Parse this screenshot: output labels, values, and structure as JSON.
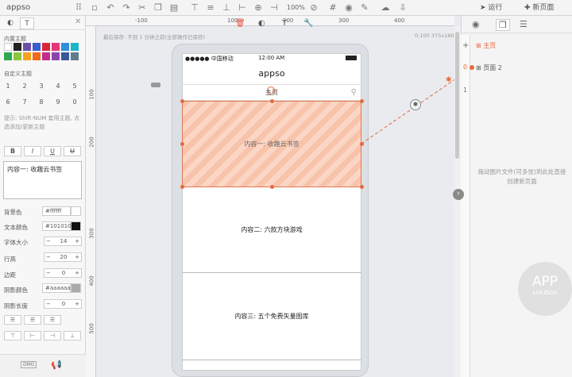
{
  "app": {
    "name": "appso"
  },
  "toolbar": {
    "zoom": "100%",
    "run_label": "运行",
    "new_page_label": "新页面"
  },
  "ruler": {
    "h": [
      "-100",
      "100",
      "200",
      "300",
      "400"
    ],
    "v": [
      "100",
      "200",
      "300",
      "400",
      "500"
    ]
  },
  "left_panel": {
    "text_tab": "T",
    "builtin_theme_label": "内置主题",
    "custom_theme_label": "自定义主题",
    "theme_colors": [
      "#ffffff",
      "#222222",
      "#6b4fa8",
      "#3a5fcd",
      "#d9263a",
      "#e6357a",
      "#2f8fd8",
      "#1fb5c9",
      "#2fa84f",
      "#8cc63e",
      "#f4a21c",
      "#f06a1d",
      "#c22c8c",
      "#8e44ad",
      "#3b5998",
      "#607d8b"
    ],
    "custom_slots": [
      "1",
      "2",
      "3",
      "4",
      "5",
      "6",
      "7",
      "8",
      "9",
      "0"
    ],
    "hint": "提示: Shift-NUM 套用主题, 点选添加/更新主题",
    "format_buttons": [
      "B",
      "I",
      "U",
      "U"
    ],
    "text_content": "内容一: 收趣云书签",
    "props": {
      "bg_label": "背景色",
      "bg_value": "#ffffff",
      "text_color_label": "文本颜色",
      "text_color_value": "#101010",
      "font_size_label": "字体大小",
      "font_size_value": "14",
      "line_height_label": "行高",
      "line_height_value": "20",
      "margin_label": "边距",
      "margin_value": "0",
      "shadow_color_label": "阴影颜色",
      "shadow_color_value": "#aaaaaa",
      "shadow_len_label": "阴影长度",
      "shadow_len_value": "0"
    },
    "bottom_label": "DMG"
  },
  "canvas": {
    "save_status": "最后保存: 不到 1 分钟之前(全部操作已保存)",
    "dims": "0:100 375x180"
  },
  "phone": {
    "carrier": "●●●●● 中国移动",
    "time": "12:00 AM",
    "title": "appso",
    "search_text": "主页",
    "content1": "内容一: 收趣云书签",
    "content2": "内容二: 六款方块游戏",
    "content3": "内容三: 五个免费矢量图库"
  },
  "right_panel": {
    "home_label": "主页",
    "page2_label": "页面 2",
    "gutter_nums": [
      "0",
      "1"
    ],
    "drop_hint": "拖动图片文件(可多张)到此处直接创建新页面",
    "watermark_top": "APP",
    "watermark_bottom": "solution"
  },
  "colors": {
    "accent": "#e46a3e",
    "selection_fill": "#f8c3aa"
  }
}
